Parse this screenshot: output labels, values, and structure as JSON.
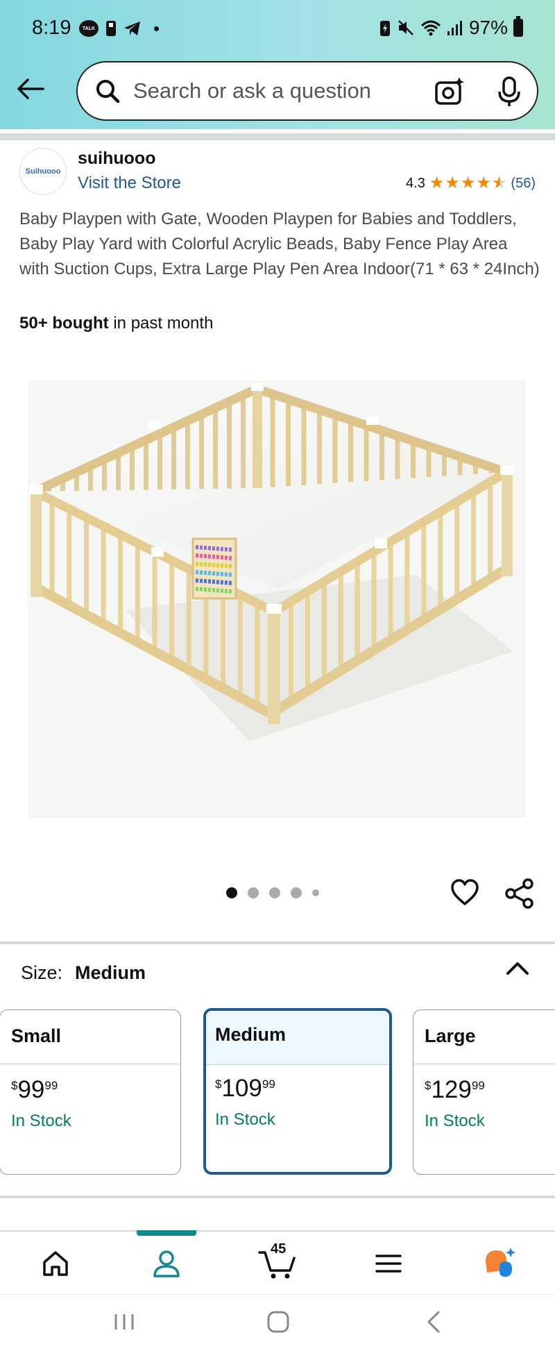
{
  "status_bar": {
    "time": "8:19",
    "talk_badge": "TALK",
    "battery": "97%"
  },
  "search": {
    "placeholder": "Search or ask a question"
  },
  "store": {
    "logo_text": "Suihuooo",
    "name": "suihuooo",
    "visit_label": "Visit the Store",
    "rating": "4.3",
    "rating_value": 4.3,
    "review_count": "(56)"
  },
  "product": {
    "title": "Baby Playpen with Gate, Wooden Playpen for Babies and Toddlers, Baby Play Yard with Colorful Acrylic Beads, Baby Fence Play Area with Suction Cups, Extra Large Play Pen Area Indoor(71 * 63 * 24Inch)",
    "bought_bold": "50+ bought",
    "bought_rest": " in past month",
    "image_count": 5,
    "active_image": 1
  },
  "size": {
    "label": "Size:",
    "selected": "Medium",
    "options": [
      {
        "name": "Small",
        "currency": "$",
        "whole": "99",
        "fraction": "99",
        "stock": "In Stock"
      },
      {
        "name": "Medium",
        "currency": "$",
        "whole": "109",
        "fraction": "99",
        "stock": "In Stock"
      },
      {
        "name": "Large",
        "currency": "$",
        "whole": "129",
        "fraction": "99",
        "stock": "In Stock"
      }
    ]
  },
  "bottom_nav": {
    "cart_count": "45",
    "active_tab": "account"
  },
  "colors": {
    "link": "#1f5a8f",
    "star": "#f08804",
    "in_stock": "#067d62",
    "selected_border": "#1f5a8f",
    "nav_indicator": "#13898f"
  }
}
